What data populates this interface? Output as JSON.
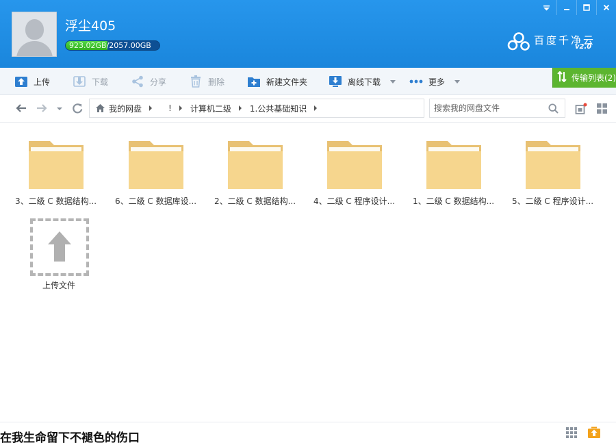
{
  "window": {
    "controls": [
      "⌵",
      "–",
      "□",
      "✕"
    ]
  },
  "user": {
    "name": "浮尘405",
    "quota_used": "923.02GB",
    "quota_total": "/2057.00GB",
    "quota_fraction": 0.4487
  },
  "brand": {
    "name": "百度千净云",
    "version": "v2.0"
  },
  "toolbar": {
    "upload": "上传",
    "download": "下载",
    "share": "分享",
    "delete": "删除",
    "new_folder": "新建文件夹",
    "offline_download": "离线下载",
    "more": "更多",
    "transfer_list": "传输列表(2)"
  },
  "breadcrumb": {
    "items": [
      "我的网盘",
      "!",
      "计算机二级",
      "1.公共基础知识"
    ]
  },
  "search": {
    "placeholder": "搜索我的网盘文件"
  },
  "files": [
    "3、二级 C 数据结构...",
    "6、二级 C 数据库设...",
    "2、二级 C 数据结构...",
    "4、二级 C 程序设计...",
    "1、二级 C 数据结构...",
    "5、二级 C 程序设计..."
  ],
  "upload_tile": {
    "label": "上传文件"
  },
  "status": {
    "text": "在我生命留下不褪色的伤口"
  },
  "colors": {
    "header_blue": "#1f8ee6",
    "quota_green": "#3fbf2b",
    "transfer_green": "#5cb530",
    "folder_yellow": "#f5d38b"
  }
}
